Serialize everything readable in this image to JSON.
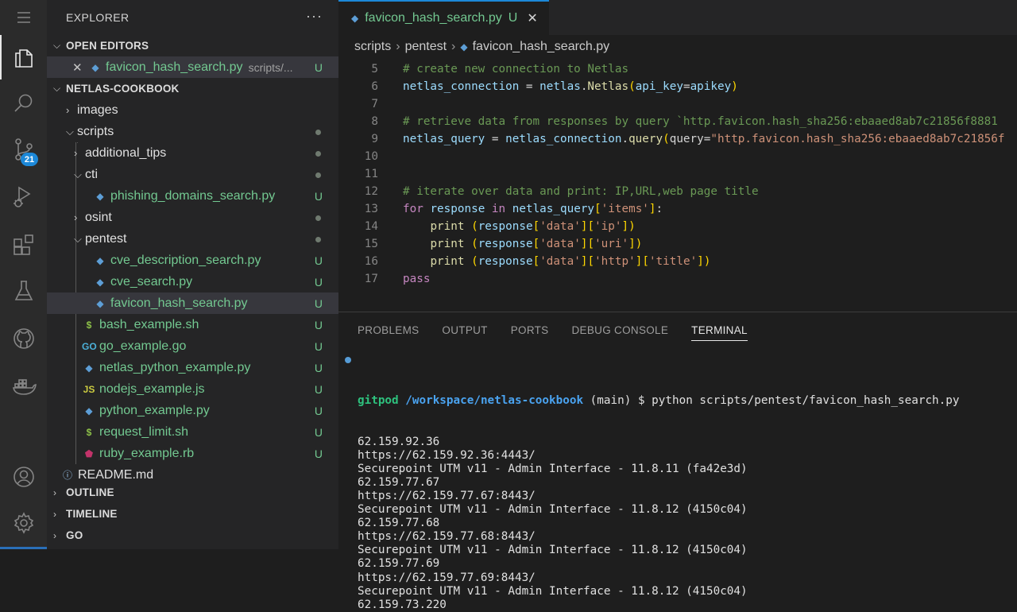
{
  "activity_bar": {
    "items": [
      {
        "name": "menu-icon"
      },
      {
        "name": "explorer-icon"
      },
      {
        "name": "search-icon"
      },
      {
        "name": "source-control-icon",
        "badge": "21"
      },
      {
        "name": "run-debug-icon"
      },
      {
        "name": "extensions-icon"
      },
      {
        "name": "testing-icon"
      },
      {
        "name": "github-icon"
      },
      {
        "name": "docker-icon"
      },
      {
        "name": "account-icon"
      },
      {
        "name": "settings-gear-icon"
      }
    ]
  },
  "sidebar": {
    "title": "EXPLORER",
    "more": "···",
    "open_editors": {
      "label": "OPEN EDITORS",
      "file": "favicon_hash_search.py",
      "path": "scripts/...",
      "status": "U"
    },
    "project": {
      "label": "NETLAS-COOKBOOK"
    },
    "tree": [
      {
        "label": "images",
        "type": "folder",
        "depth": 0,
        "open": false,
        "dot": false
      },
      {
        "label": "scripts",
        "type": "folder",
        "depth": 0,
        "open": true,
        "dot": true
      },
      {
        "label": "additional_tips",
        "type": "folder",
        "depth": 1,
        "open": false,
        "dot": true
      },
      {
        "label": "cti",
        "type": "folder",
        "depth": 1,
        "open": true,
        "dot": true
      },
      {
        "label": "phishing_domains_search.py",
        "type": "py",
        "depth": 2,
        "status": "U"
      },
      {
        "label": "osint",
        "type": "folder",
        "depth": 1,
        "open": false,
        "dot": true
      },
      {
        "label": "pentest",
        "type": "folder",
        "depth": 1,
        "open": true,
        "dot": true
      },
      {
        "label": "cve_description_search.py",
        "type": "py",
        "depth": 2,
        "status": "U"
      },
      {
        "label": "cve_search.py",
        "type": "py",
        "depth": 2,
        "status": "U"
      },
      {
        "label": "favicon_hash_search.py",
        "type": "py",
        "depth": 2,
        "status": "U",
        "selected": true
      },
      {
        "label": "bash_example.sh",
        "type": "sh",
        "depth": 1,
        "status": "U"
      },
      {
        "label": "go_example.go",
        "type": "go",
        "depth": 1,
        "status": "U"
      },
      {
        "label": "netlas_python_example.py",
        "type": "py",
        "depth": 1,
        "status": "U"
      },
      {
        "label": "nodejs_example.js",
        "type": "js",
        "depth": 1,
        "status": "U"
      },
      {
        "label": "python_example.py",
        "type": "py",
        "depth": 1,
        "status": "U"
      },
      {
        "label": "request_limit.sh",
        "type": "sh",
        "depth": 1,
        "status": "U"
      },
      {
        "label": "ruby_example.rb",
        "type": "rb",
        "depth": 1,
        "status": "U"
      },
      {
        "label": "README.md",
        "type": "info",
        "depth": 0
      }
    ],
    "bottom_sections": [
      "OUTLINE",
      "TIMELINE",
      "GO"
    ]
  },
  "editor": {
    "tab": {
      "label": "favicon_hash_search.py",
      "status": "U",
      "close": "✕"
    },
    "breadcrumb": [
      "scripts",
      "pentest",
      "favicon_hash_search.py"
    ],
    "lines": [
      {
        "n": "5",
        "text": "# create new connection to Netlas"
      },
      {
        "n": "6",
        "text": "netlas_connection = netlas.Netlas(api_key=apikey)"
      },
      {
        "n": "7",
        "text": ""
      },
      {
        "n": "8",
        "text": "# retrieve data from responses by query `http.favicon.hash_sha256:ebaaed8ab7c21856f8881"
      },
      {
        "n": "9",
        "text": "netlas_query = netlas_connection.query(query=\"http.favicon.hash_sha256:ebaaed8ab7c21856f"
      },
      {
        "n": "10",
        "text": ""
      },
      {
        "n": "11",
        "text": ""
      },
      {
        "n": "12",
        "text": "# iterate over data and print: IP,URL,web page title"
      },
      {
        "n": "13",
        "text": "for response in netlas_query['items']:"
      },
      {
        "n": "14",
        "text": "    print (response['data']['ip'])"
      },
      {
        "n": "15",
        "text": "    print (response['data']['uri'])"
      },
      {
        "n": "16",
        "text": "    print (response['data']['http']['title'])"
      },
      {
        "n": "17",
        "text": "pass"
      }
    ]
  },
  "panel": {
    "tabs": [
      "PROBLEMS",
      "OUTPUT",
      "PORTS",
      "DEBUG CONSOLE",
      "TERMINAL"
    ],
    "active_tab": "TERMINAL",
    "prompt": {
      "user": "gitpod",
      "path": "/workspace/netlas-cookbook",
      "branch": "(main)",
      "command": "$ python scripts/pentest/favicon_hash_search.py"
    },
    "output": [
      "62.159.92.36",
      "https://62.159.92.36:4443/",
      "Securepoint UTM v11 - Admin Interface - 11.8.11 (fa42e3d)",
      "62.159.77.67",
      "https://62.159.77.67:8443/",
      "Securepoint UTM v11 - Admin Interface - 11.8.12 (4150c04)",
      "62.159.77.68",
      "https://62.159.77.68:8443/",
      "Securepoint UTM v11 - Admin Interface - 11.8.12 (4150c04)",
      "62.159.77.69",
      "https://62.159.77.69:8443/",
      "Securepoint UTM v11 - Admin Interface - 11.8.12 (4150c04)",
      "62.159.73.220"
    ]
  }
}
